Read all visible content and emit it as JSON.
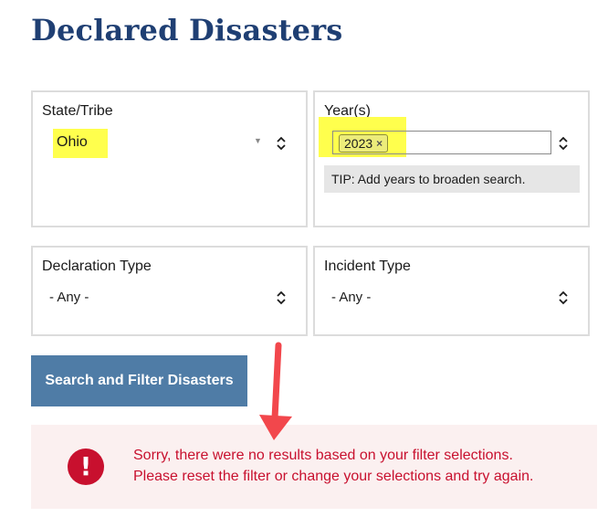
{
  "page": {
    "title": "Declared Disasters"
  },
  "filters": {
    "state": {
      "label": "State/Tribe",
      "value": "Ohio"
    },
    "years": {
      "label": "Year(s)",
      "selected": [
        "2023"
      ],
      "tag_remove_glyph": "×",
      "tip": "TIP: Add years to broaden search."
    },
    "declaration_type": {
      "label": "Declaration Type",
      "value": "- Any -"
    },
    "incident_type": {
      "label": "Incident Type",
      "value": "- Any -"
    }
  },
  "actions": {
    "search_label": "Search and Filter Disasters"
  },
  "alert": {
    "icon_glyph": "!",
    "line1": "Sorry, there were no results based on your filter selections.",
    "line2": "Please reset the filter or change your selections and try again."
  },
  "colors": {
    "title": "#1f3f73",
    "button_bg": "#4f7ca6",
    "highlight": "#ffff4d",
    "alert_bg": "#fbf0f0",
    "alert_text": "#c8102e",
    "arrow": "#f2474c"
  },
  "icons": {
    "select_caret": "caret-down-icon",
    "select_updown": "chevron-up-down-icon",
    "tag_remove": "close-icon",
    "alert": "error-circle-icon",
    "annotation": "arrow-down-icon"
  }
}
